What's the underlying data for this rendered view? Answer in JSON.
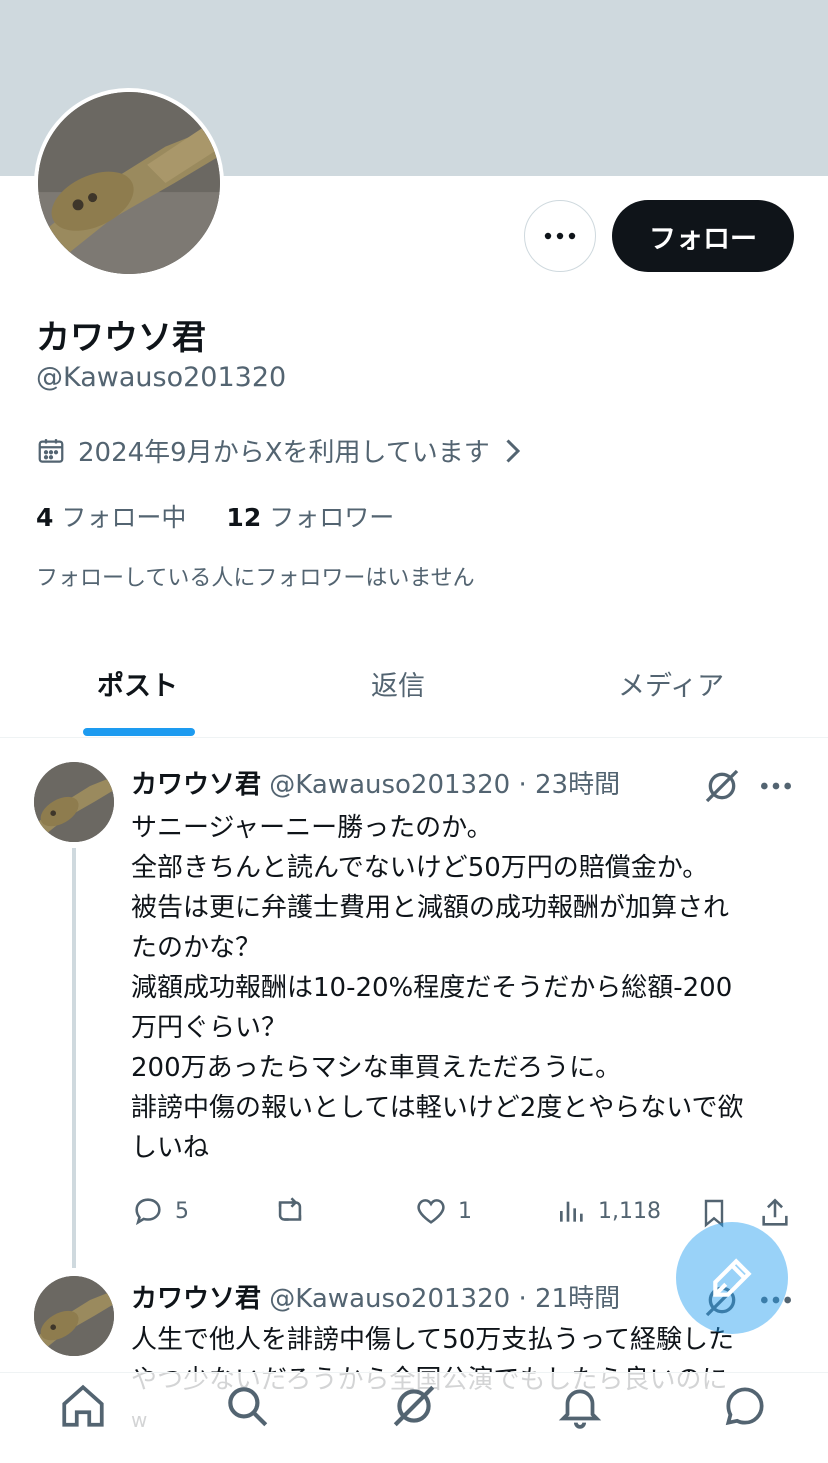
{
  "profile": {
    "follow_label": "フォロー",
    "display_name": "カワウソ君",
    "handle": "@Kawauso201320",
    "joined": "2024年9月からXを利用しています",
    "following_count": "4",
    "following_label": "フォロー中",
    "followers_count": "12",
    "followers_label": "フォロワー",
    "followed_note": "フォローしている人にフォロワーはいません"
  },
  "tabs": [
    {
      "label": "ポスト",
      "active": true
    },
    {
      "label": "返信",
      "active": false
    },
    {
      "label": "メディア",
      "active": false
    }
  ],
  "tweets": [
    {
      "name": "カワウソ君",
      "meta": "@Kawauso201320 · 23時間",
      "lines": [
        "サニージャーニー勝ったのか。",
        "全部きちんと読んでないけど50万円の賠償金か。",
        "被告は更に弁護士費用と減額の成功報酬が加算され",
        "たのかな？",
        "減額成功報酬は10-20%程度だそうだから総額-200",
        "万円ぐらい？",
        "200万あったらマシな車買えただろうに。",
        "誹謗中傷の報いとしては軽いけど2度とやらないで欲",
        "しいね"
      ],
      "replies": "5",
      "likes": "1",
      "views": "1,118"
    },
    {
      "name": "カワウソ君",
      "meta": "@Kawauso201320 · 21時間",
      "lines": [
        "人生で他人を誹謗中傷して50万支払うって経験した",
        "やつ少ないだろうから全国公演でもしたら良いのに",
        "w"
      ]
    }
  ],
  "colors": {
    "banner": "#cfd9de",
    "accent": "#1d9bf0",
    "text_primary": "#0f1419",
    "text_secondary": "#536471"
  },
  "icons": [
    "more-icon",
    "calendar-icon",
    "chevron-right-icon",
    "grok-icon",
    "reply-icon",
    "retweet-icon",
    "like-icon",
    "views-icon",
    "bookmark-icon",
    "share-icon",
    "compose-icon",
    "home-icon",
    "search-icon",
    "notifications-icon",
    "messages-icon"
  ]
}
